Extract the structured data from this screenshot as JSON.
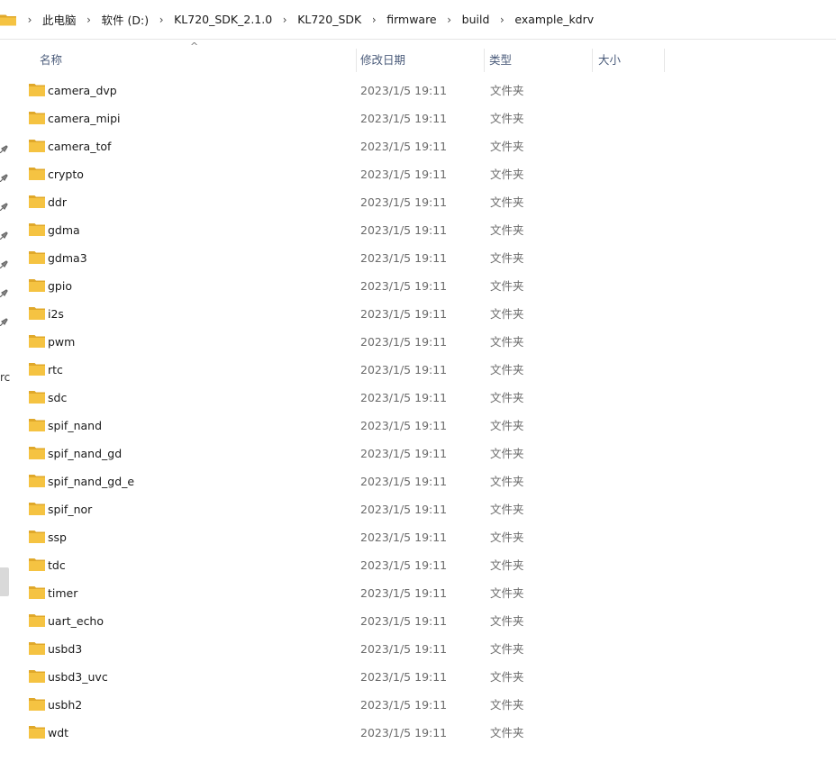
{
  "breadcrumb": {
    "segments": [
      "此电脑",
      "软件 (D:)",
      "KL720_SDK_2.1.0",
      "KL720_SDK",
      "firmware",
      "build",
      "example_kdrv"
    ]
  },
  "nav": {
    "fragment_text": "rc"
  },
  "columns": {
    "name": "名称",
    "date": "修改日期",
    "type": "类型",
    "size": "大小",
    "sort_indicator": "^"
  },
  "colors": {
    "folder": "#f5c342",
    "folder_dark": "#e0a82a",
    "header_text": "#4a5b7a"
  },
  "files": [
    {
      "name": "camera_dvp",
      "date": "2023/1/5 19:11",
      "type": "文件夹",
      "size": ""
    },
    {
      "name": "camera_mipi",
      "date": "2023/1/5 19:11",
      "type": "文件夹",
      "size": ""
    },
    {
      "name": "camera_tof",
      "date": "2023/1/5 19:11",
      "type": "文件夹",
      "size": ""
    },
    {
      "name": "crypto",
      "date": "2023/1/5 19:11",
      "type": "文件夹",
      "size": ""
    },
    {
      "name": "ddr",
      "date": "2023/1/5 19:11",
      "type": "文件夹",
      "size": ""
    },
    {
      "name": "gdma",
      "date": "2023/1/5 19:11",
      "type": "文件夹",
      "size": ""
    },
    {
      "name": "gdma3",
      "date": "2023/1/5 19:11",
      "type": "文件夹",
      "size": ""
    },
    {
      "name": "gpio",
      "date": "2023/1/5 19:11",
      "type": "文件夹",
      "size": ""
    },
    {
      "name": "i2s",
      "date": "2023/1/5 19:11",
      "type": "文件夹",
      "size": ""
    },
    {
      "name": "pwm",
      "date": "2023/1/5 19:11",
      "type": "文件夹",
      "size": ""
    },
    {
      "name": "rtc",
      "date": "2023/1/5 19:11",
      "type": "文件夹",
      "size": ""
    },
    {
      "name": "sdc",
      "date": "2023/1/5 19:11",
      "type": "文件夹",
      "size": ""
    },
    {
      "name": "spif_nand",
      "date": "2023/1/5 19:11",
      "type": "文件夹",
      "size": ""
    },
    {
      "name": "spif_nand_gd",
      "date": "2023/1/5 19:11",
      "type": "文件夹",
      "size": ""
    },
    {
      "name": "spif_nand_gd_e",
      "date": "2023/1/5 19:11",
      "type": "文件夹",
      "size": ""
    },
    {
      "name": "spif_nor",
      "date": "2023/1/5 19:11",
      "type": "文件夹",
      "size": ""
    },
    {
      "name": "ssp",
      "date": "2023/1/5 19:11",
      "type": "文件夹",
      "size": ""
    },
    {
      "name": "tdc",
      "date": "2023/1/5 19:11",
      "type": "文件夹",
      "size": ""
    },
    {
      "name": "timer",
      "date": "2023/1/5 19:11",
      "type": "文件夹",
      "size": ""
    },
    {
      "name": "uart_echo",
      "date": "2023/1/5 19:11",
      "type": "文件夹",
      "size": ""
    },
    {
      "name": "usbd3",
      "date": "2023/1/5 19:11",
      "type": "文件夹",
      "size": ""
    },
    {
      "name": "usbd3_uvc",
      "date": "2023/1/5 19:11",
      "type": "文件夹",
      "size": ""
    },
    {
      "name": "usbh2",
      "date": "2023/1/5 19:11",
      "type": "文件夹",
      "size": ""
    },
    {
      "name": "wdt",
      "date": "2023/1/5 19:11",
      "type": "文件夹",
      "size": ""
    }
  ]
}
